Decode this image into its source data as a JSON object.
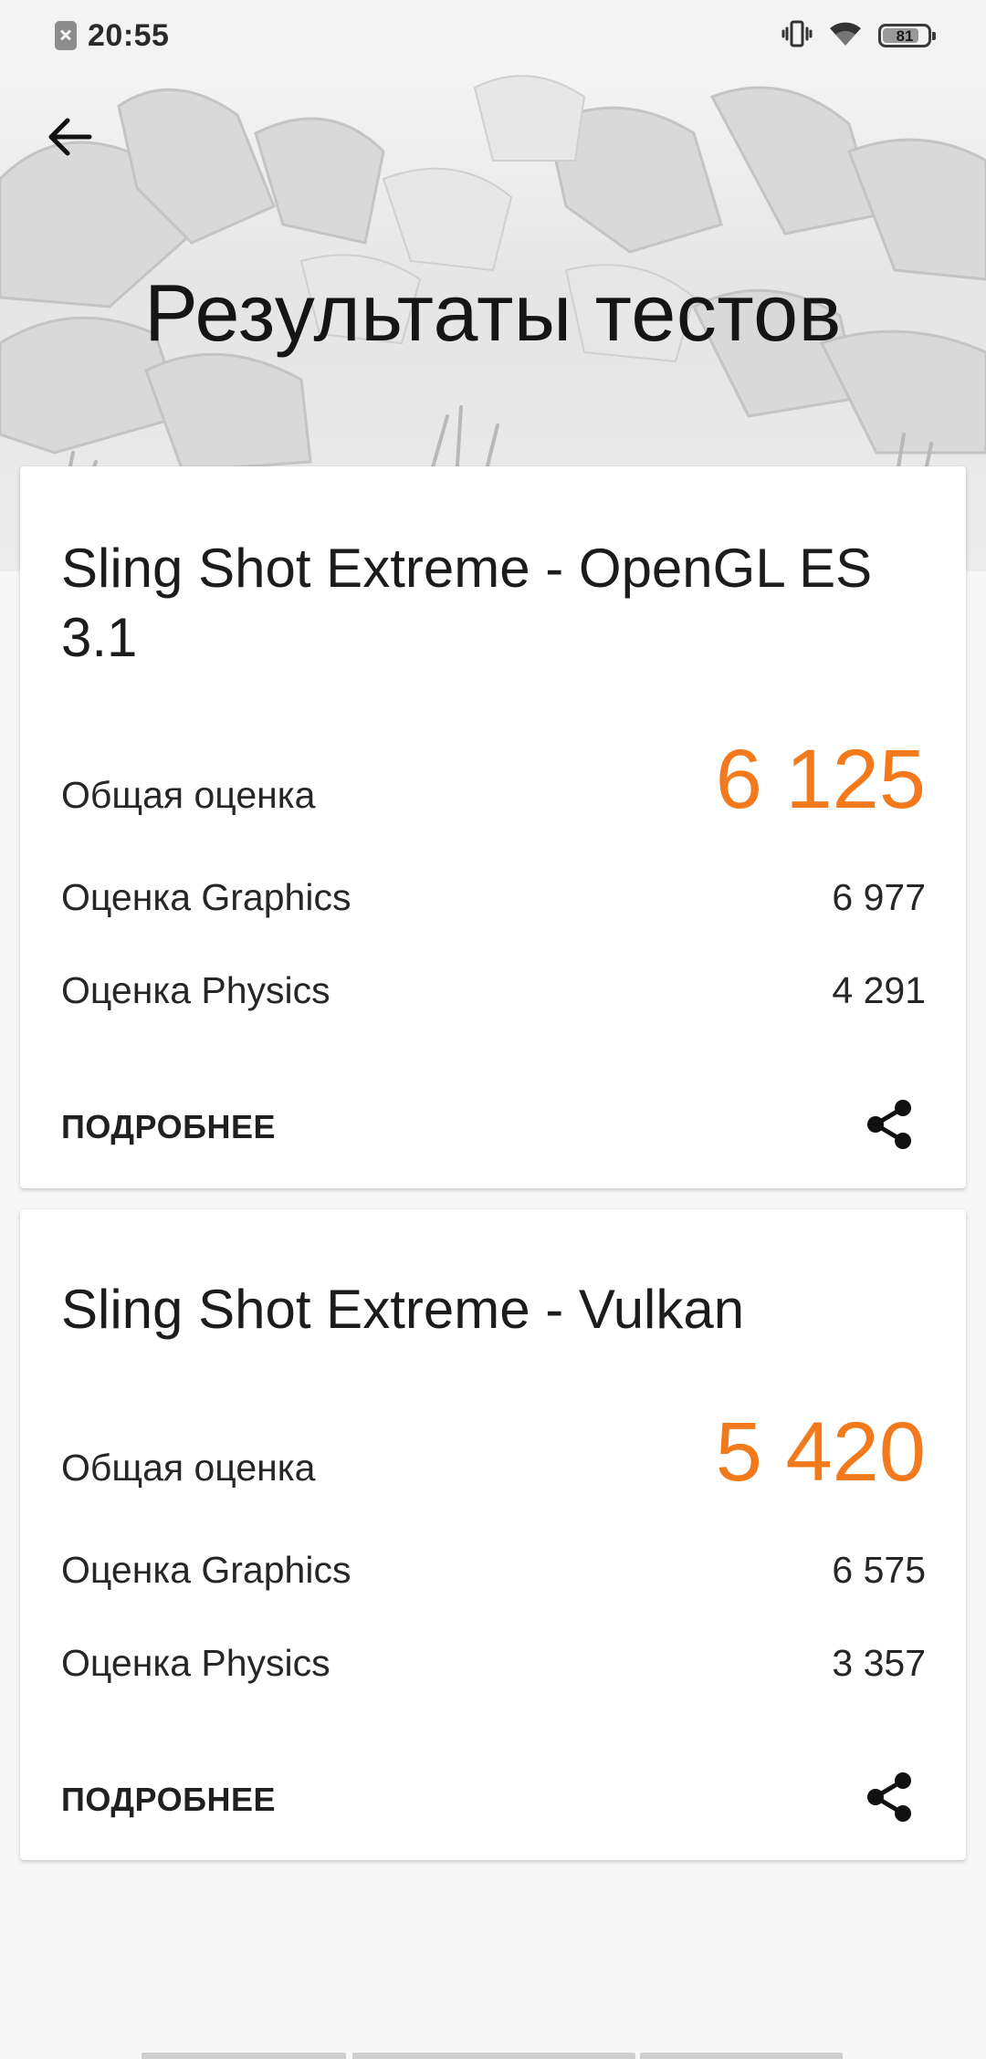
{
  "status_bar": {
    "time": "20:55",
    "battery_level": "81",
    "battery_fraction": 0.81,
    "icons": [
      "notification-blocked-icon",
      "vibrate-icon",
      "wifi-icon",
      "battery-icon"
    ]
  },
  "header": {
    "title": "Результаты тестов",
    "back_icon": "arrow-left-icon"
  },
  "results": [
    {
      "title": "Sling Shot Extreme - OpenGL ES 3.1",
      "total_label": "Общая оценка",
      "total_value": "6 125",
      "graphics_label": "Оценка Graphics",
      "graphics_value": "6 977",
      "physics_label": "Оценка Physics",
      "physics_value": "4 291",
      "details_label": "ПОДРОБНЕЕ",
      "share_icon": "share-icon"
    },
    {
      "title": "Sling Shot Extreme - Vulkan",
      "total_label": "Общая оценка",
      "total_value": "5 420",
      "graphics_label": "Оценка Graphics",
      "graphics_value": "6 575",
      "physics_label": "Оценка Physics",
      "physics_value": "3 357",
      "details_label": "ПОДРОБНЕЕ",
      "share_icon": "share-icon"
    }
  ],
  "colors": {
    "accent": "#f27a1c",
    "text": "#1f1f1f",
    "background": "#f7f7f7",
    "card": "#ffffff"
  }
}
